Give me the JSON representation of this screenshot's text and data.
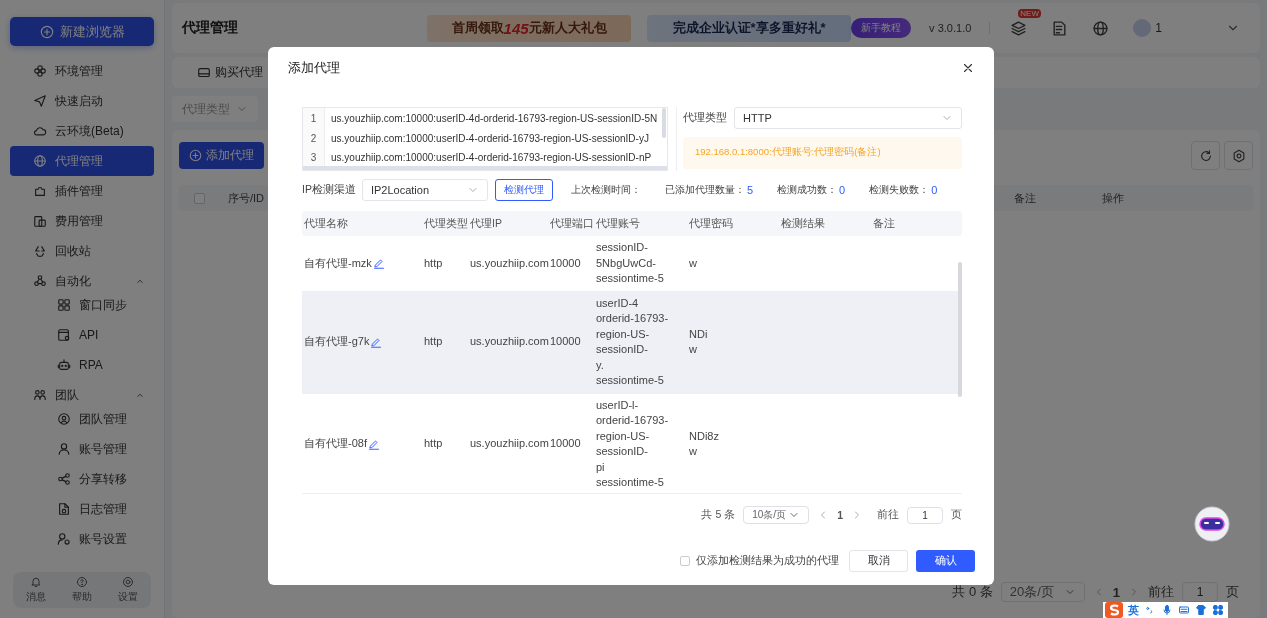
{
  "sidebar": {
    "new_button": "新建浏览器",
    "items": [
      {
        "label": "环境管理",
        "selected": false
      },
      {
        "label": "快速启动",
        "selected": false
      },
      {
        "label": "云环境(Beta)",
        "selected": false
      },
      {
        "label": "代理管理",
        "selected": true
      },
      {
        "label": "插件管理",
        "selected": false
      },
      {
        "label": "费用管理",
        "selected": false
      },
      {
        "label": "回收站",
        "selected": false
      },
      {
        "label": "自动化",
        "expanded": true,
        "children": [
          {
            "label": "窗口同步",
            "selected": false
          },
          {
            "label": "API",
            "selected": false
          },
          {
            "label": "RPA",
            "selected": false
          }
        ]
      },
      {
        "label": "团队",
        "expanded": true,
        "children": [
          {
            "label": "团队管理",
            "selected": false
          },
          {
            "label": "账号管理",
            "selected": false
          },
          {
            "label": "分享转移",
            "selected": false
          },
          {
            "label": "日志管理",
            "selected": false
          },
          {
            "label": "账号设置",
            "selected": false
          }
        ]
      }
    ],
    "footer": [
      "消息",
      "帮助",
      "设置"
    ]
  },
  "header": {
    "title": "代理管理",
    "banners": [
      "首周领取**145**元新人大礼包",
      "完成企业认证*享多重好礼*"
    ],
    "tutorial_badge": "新手教程",
    "version": "v 3.0.1.0",
    "new_badge": "NEW",
    "user": "1"
  },
  "page": {
    "tabs": [
      {
        "label": "购买代理",
        "selected": false
      }
    ],
    "filter": "代理类型",
    "add_button": "添加代理",
    "select_all": {
      "checked": false
    },
    "columns": [
      "序号/ID",
      "备注",
      "操作"
    ],
    "pagination": {
      "total": "共 0 条",
      "page_size": "20条/页",
      "current": "1",
      "goto_label": "前往",
      "goto_value": "1",
      "unit": "页"
    }
  },
  "dialog": {
    "title": "添加代理",
    "proxy_lines": [
      {
        "number": "1",
        "text": "us.youzhiip.com:10000:userID-4d-orderid-16793-region-US-sessionID-5N"
      },
      {
        "number": "2",
        "text": "us.youzhiip.com:10000:userID-4-orderid-16793-region-US-sessionID-yJ"
      },
      {
        "number": "3",
        "text": "us.youzhiip.com:10000:userID-4-orderid-16793-region-US-sessionID-nP"
      }
    ],
    "type_label": "代理类型",
    "type_value": "HTTP",
    "format_hint": "192.168.0.1:8000:代理账号:代理密码(备注)",
    "channel_label": "IP检测渠道",
    "channel_value": "IP2Location",
    "check_button": "检测代理",
    "stats": [
      {
        "label": "上次检测时间："
      },
      {
        "label": "已添加代理数量：",
        "value": "5"
      },
      {
        "label": "检测成功数：",
        "value": "0"
      },
      {
        "label": "检测失败数：",
        "value": "0"
      }
    ],
    "columns": [
      "代理名称",
      "代理类型",
      "代理IP",
      "代理端口",
      "代理账号",
      "代理密码",
      "检测结果",
      "备注"
    ],
    "rows": [
      {
        "name": "自有代理-mzk",
        "type": "http",
        "ip": "us.youzhiip.com",
        "port": "10000",
        "account": "sessionID-\n5NbgUwCd-\nsessiontime-5",
        "password": "w",
        "highlighted": false
      },
      {
        "name": "自有代理-g7k",
        "type": "http",
        "ip": "us.youzhiip.com",
        "port": "10000",
        "account": "userID-4\norderid-16793-\nregion-US-\nsessionID-\ny.\nsessiontime-5",
        "password": "NDi\nw",
        "highlighted": true
      },
      {
        "name": "自有代理-08f",
        "type": "http",
        "ip": "us.youzhiip.com",
        "port": "10000",
        "account": "userID-l-\norderid-16793-\nregion-US-\nsessionID-\npi\nsessiontime-5",
        "password": "NDi8z\nw",
        "highlighted": false
      }
    ],
    "pagination": {
      "total": "共 5 条",
      "page_size": "10条/页",
      "current": "1",
      "goto_label": "前往",
      "goto_value": "1",
      "unit": "页"
    },
    "only_success": {
      "label": "仅添加检测结果为成功的代理",
      "checked": false
    },
    "cancel": "取消",
    "confirm": "确认"
  },
  "ime": {
    "mode": "英"
  }
}
